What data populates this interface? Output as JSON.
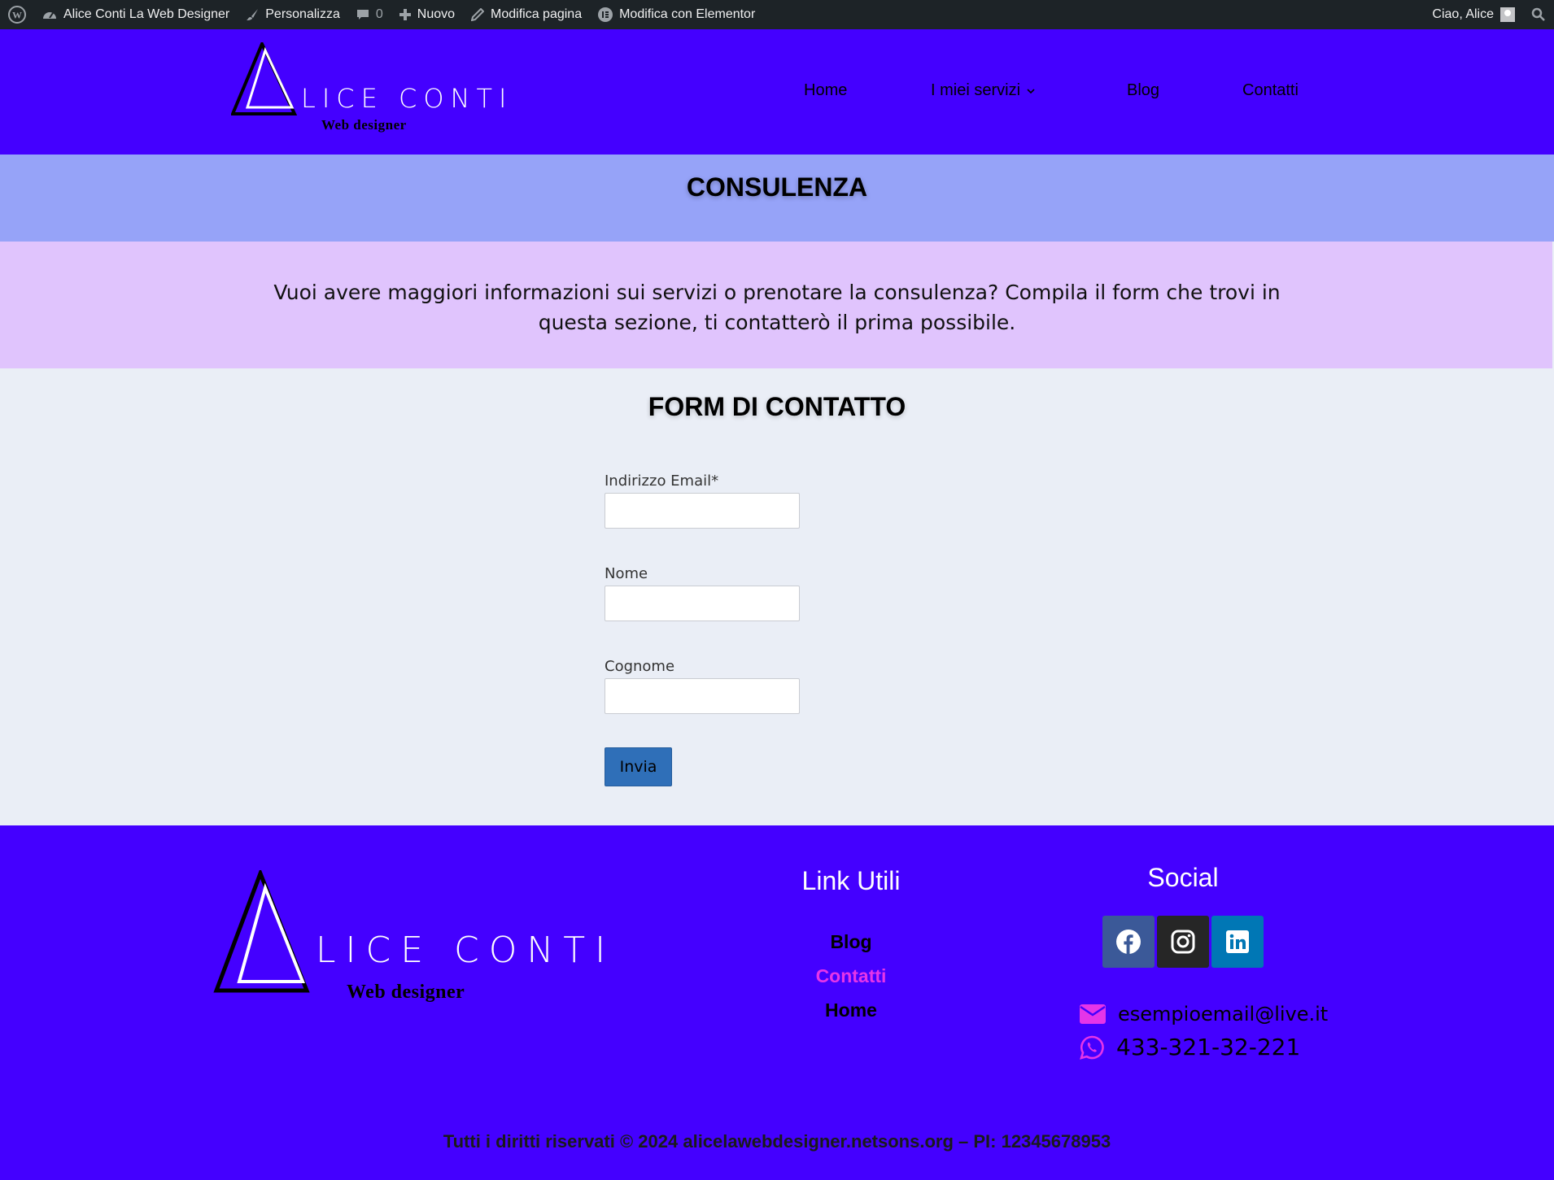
{
  "adminbar": {
    "site_name": "Alice Conti La Web Designer",
    "customize": "Personalizza",
    "comments_count": "0",
    "new": "Nuovo",
    "edit_page": "Modifica pagina",
    "edit_elementor": "Modifica con Elementor",
    "greeting": "Ciao, Alice"
  },
  "header": {
    "logo_name": "LICE CONTI",
    "logo_sub": "Web designer",
    "nav": [
      "Home",
      "I miei servizi",
      "Blog",
      "Contatti"
    ]
  },
  "page_title": "CONSULENZA",
  "intro": "Vuoi avere maggiori informazioni sui servizi o prenotare la consulenza? Compila il form che trovi in questa sezione, ti contatterò il prima possibile.",
  "form": {
    "title": "FORM DI CONTATTO",
    "email_label": "Indirizzo Email*",
    "email_value": "",
    "name_label": "Nome",
    "name_value": "",
    "surname_label": "Cognome",
    "surname_value": "",
    "submit": "Invia"
  },
  "footer": {
    "logo_name": "LICE CONTI",
    "logo_sub": "Web designer",
    "links_title": "Link Utili",
    "links": [
      {
        "label": "Blog",
        "color": "#000000"
      },
      {
        "label": "Contatti",
        "color": "#e535e8"
      },
      {
        "label": "Home",
        "color": "#000000"
      }
    ],
    "social_title": "Social",
    "social": [
      {
        "name": "facebook-icon",
        "color": "#3b5998"
      },
      {
        "name": "instagram-icon",
        "color": "#262626"
      },
      {
        "name": "linkedin-icon",
        "color": "#0077b5"
      }
    ],
    "email": "esempioemail@live.it",
    "phone": "433-321-32-221",
    "copyright": "Tutti i diritti riservati © 2024 alicelawebdesigner.netsons.org – PI: 12345678953"
  },
  "colors": {
    "primary": "#4400ff",
    "title_band": "#96a3f8",
    "intro_band": "#e0c4fd",
    "accent_pink": "#e535e8",
    "button": "#2f6fb8"
  }
}
